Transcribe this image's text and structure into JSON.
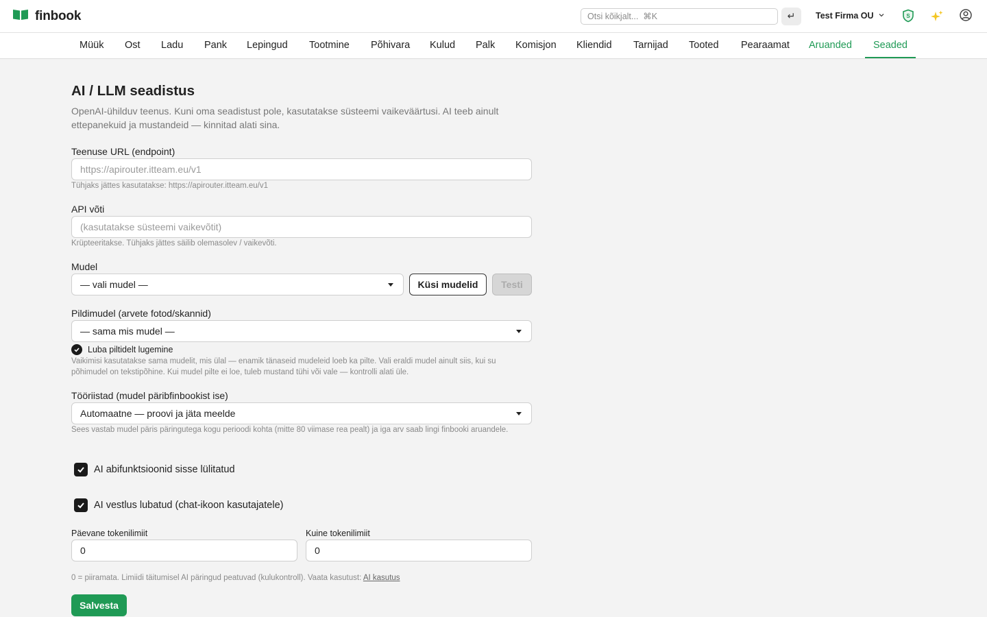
{
  "app": {
    "name": "finbook",
    "brand_color": "#1f9a55"
  },
  "header": {
    "search_placeholder": "Otsi kõikjalt...  ⌘K",
    "enter_glyph": "↵",
    "company": "Test Firma OU",
    "icons": [
      "logo-book-icon",
      "shield-s-icon",
      "sparkles-icon",
      "user-circle-icon",
      "chevron-down-icon"
    ]
  },
  "nav": {
    "items": [
      "Müük",
      "Ost",
      "Ladu",
      "Pank",
      "Lepingud",
      "Tootmine",
      "Põhivara",
      "Kulud",
      "Palk",
      "Komisjon",
      "Kliendid",
      "Tarnijad",
      "Tooted",
      "Pearaamat",
      "Aruanded",
      "Seaded"
    ],
    "active": "Seaded"
  },
  "page": {
    "title": "AI / LLM seadistus",
    "intro": "OpenAI-ühilduv teenus. Kuni oma seadistust pole, kasutatakse süsteemi vaikeväärtusi. AI teeb ainult ettepanekuid ja mustandeid — kinnitad alati sina."
  },
  "form": {
    "endpoint": {
      "label": "Teenuse URL (endpoint)",
      "placeholder": "https://apirouter.itteam.eu/v1",
      "value": "",
      "help": "Tühjaks jättes kasutatakse: https://apirouter.itteam.eu/v1"
    },
    "api_key": {
      "label": "API võti",
      "placeholder": "(kasutatakse süsteemi vaikevõtit)",
      "value": "",
      "help": "Krüpteeritakse. Tühjaks jättes säilib olemasolev / vaikevõti."
    },
    "model": {
      "label": "Mudel",
      "selected": "— vali mudel —",
      "fetch_button": "Küsi mudelid",
      "test_button": "Testi"
    },
    "image_model": {
      "label": "Pildimudel (arvete fotod/skannid)",
      "selected": "— sama mis mudel —",
      "vision_checkbox": "Luba piltidelt lugemine",
      "vision_checked": true,
      "help": "Vaikimisi kasutatakse sama mudelit, mis ülal — enamik tänaseid mudeleid loeb ka pilte. Vali eraldi mudel ainult siis, kui su põhimudel on tekstipõhine. Kui mudel pilte ei loe, tuleb mustand tühi või vale — kontrolli alati üle."
    },
    "tools": {
      "label": "Tööriistad (mudel päribfinbookist ise)",
      "selected": "Automaatne — proovi ja jäta meelde",
      "help": "Sees vastab mudel päris päringutega kogu perioodi kohta (mitte 80 viimase rea pealt) ja iga arv saab lingi finbooki aruandele."
    },
    "ai_enabled": {
      "label": "AI abifunktsioonid sisse lülitatud",
      "checked": true
    },
    "chat_enabled": {
      "label": "AI vestlus lubatud (chat-ikoon kasutajatele)",
      "checked": true
    },
    "daily_limit": {
      "label": "Päevane tokenilimiit",
      "value": "0"
    },
    "monthly_limit": {
      "label": "Kuine tokenilimiit",
      "value": "0"
    },
    "limits_help": "0 = piiramata. Limiidi täitumisel AI päringud peatuvad (kulukontroll). Vaata kasutust:",
    "limits_link": "AI kasutus",
    "save_button": "Salvesta"
  }
}
